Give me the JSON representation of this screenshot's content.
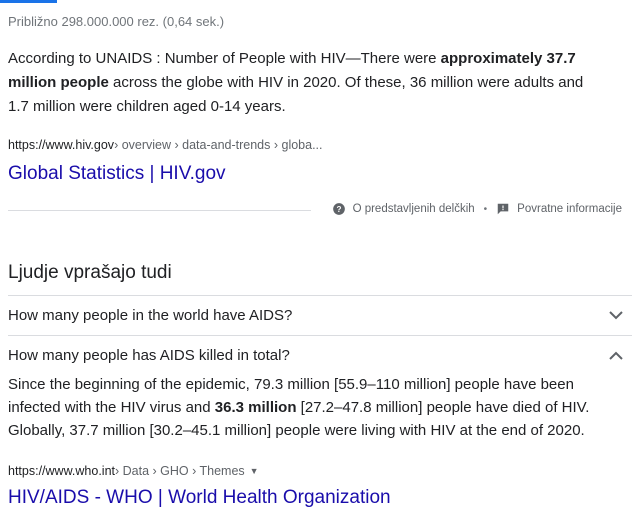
{
  "result_stats": "Približno 298.000.000 rez. (0,64 sek.)",
  "featured_snippet": {
    "text_before": "According to UNAIDS : Number of People with HIV—There were ",
    "text_bold": "approximately 37.7 million people",
    "text_after": " across the globe with HIV in 2020. Of these, 36 million were adults and 1.7 million were children aged 0-14 years.",
    "cite_domain": "https://www.hiv.gov",
    "cite_path": " › overview › data-and-trends › globa...",
    "title": "Global Statistics | HIV.gov"
  },
  "feedback": {
    "about_label": "O predstavljenih delčkih",
    "separator": "•",
    "feedback_label": "Povratne informacije",
    "about_icon": "help-circle-icon",
    "feedback_icon": "feedback-flag-icon"
  },
  "paa": {
    "heading": "Ljudje vprašajo tudi",
    "questions": [
      {
        "text": "How many people in the world have AIDS?",
        "expanded": false
      },
      {
        "text": "How many people has AIDS killed in total?",
        "expanded": true
      }
    ],
    "answer": {
      "text_before": "Since the beginning of the epidemic, 79.3 million [55.9–110 million] people have been infected with the HIV virus and ",
      "text_bold": "36.3 million",
      "text_after": " [27.2–47.8 million] people have died of HIV. Globally, 37.7 million [30.2–45.1 million] people were living with HIV at the end of 2020."
    },
    "cite_domain": "https://www.who.int",
    "cite_path": " › Data › GHO › Themes",
    "cite_caret": "▼",
    "result_title": "HIV/AIDS - WHO | World Health Organization"
  },
  "colors": {
    "link": "#1a0dab",
    "accent": "#1a73e8",
    "muted": "#70757a",
    "divider": "#dadce0"
  }
}
